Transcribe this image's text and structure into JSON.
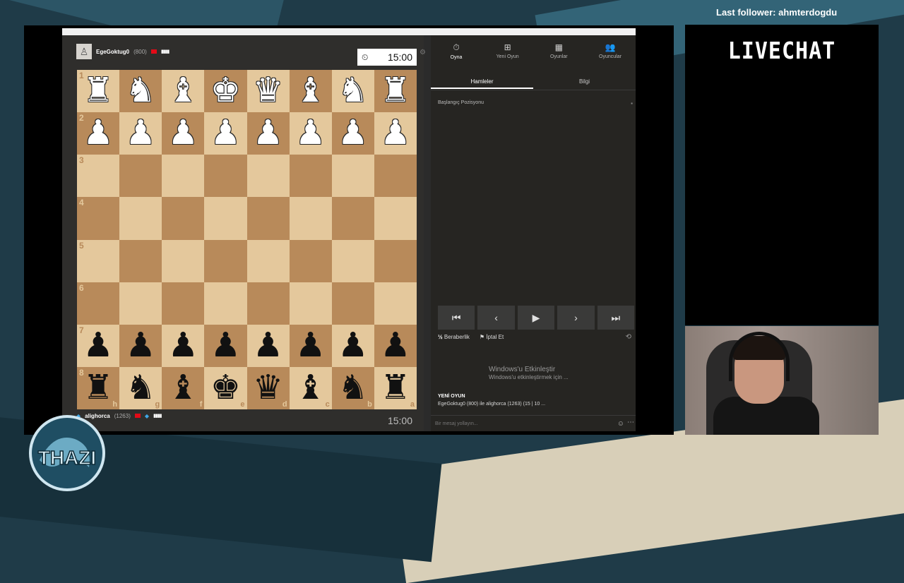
{
  "stream": {
    "last_follower": "Last follower: ahmterdogdu",
    "livechat_title": "LIVECHAT",
    "logo_text": "THAZI"
  },
  "players": {
    "top": {
      "name": "EgeGoktug0",
      "rating": "(800)",
      "clock": "15:00"
    },
    "bottom": {
      "name": "alighorca",
      "rating": "(1263)",
      "clock": "15:00"
    }
  },
  "board": {
    "ranks": [
      "1",
      "2",
      "3",
      "4",
      "5",
      "6",
      "7",
      "8"
    ],
    "files": [
      "h",
      "g",
      "f",
      "e",
      "d",
      "c",
      "b",
      "a"
    ],
    "rows": [
      [
        "♜",
        "♞",
        "♝",
        "♚",
        "♛",
        "♝",
        "♞",
        "♜"
      ],
      [
        "♟",
        "♟",
        "♟",
        "♟",
        "♟",
        "♟",
        "♟",
        "♟"
      ],
      [
        "",
        "",
        "",
        "",
        "",
        "",
        "",
        ""
      ],
      [
        "",
        "",
        "",
        "",
        "",
        "",
        "",
        ""
      ],
      [
        "",
        "",
        "",
        "",
        "",
        "",
        "",
        ""
      ],
      [
        "",
        "",
        "",
        "",
        "",
        "",
        "",
        ""
      ],
      [
        "♟",
        "♟",
        "♟",
        "♟",
        "♟",
        "♟",
        "♟",
        "♟"
      ],
      [
        "♜",
        "♞",
        "♝",
        "♚",
        "♛",
        "♝",
        "♞",
        "♜"
      ]
    ],
    "row_colors": [
      "white",
      "white",
      "",
      "",
      "",
      "",
      "black",
      "black"
    ]
  },
  "nav": {
    "items": [
      {
        "label": "Oyna",
        "icon": "clock-icon",
        "glyph": "⏱"
      },
      {
        "label": "Yeni Oyun",
        "icon": "plus-icon",
        "glyph": "⊞"
      },
      {
        "label": "Oyunlar",
        "icon": "board-icon",
        "glyph": "▦"
      },
      {
        "label": "Oyuncular",
        "icon": "players-icon",
        "glyph": "👥"
      }
    ]
  },
  "tabs": {
    "moves": "Hamleler",
    "info": "Bilgi"
  },
  "moves": {
    "start_position": "Başlangıç Pozisyonu"
  },
  "controls": {
    "first": "⏮",
    "prev": "‹",
    "play": "▶",
    "next": "›",
    "last": "⏭"
  },
  "actions": {
    "draw": "Beraberlik",
    "draw_icon": "½",
    "abort": "İptal Et"
  },
  "chat": {
    "title": "YENİ OYUN",
    "message": "EgeGoktug0 (800) ile alighorca (1263) (15 | 10 ...",
    "placeholder": "Bir mesaj yollayın..."
  },
  "watermark": {
    "line1": "Windows'u Etkinleştir",
    "line2": "Windows'u etkinleştirmek için ..."
  }
}
